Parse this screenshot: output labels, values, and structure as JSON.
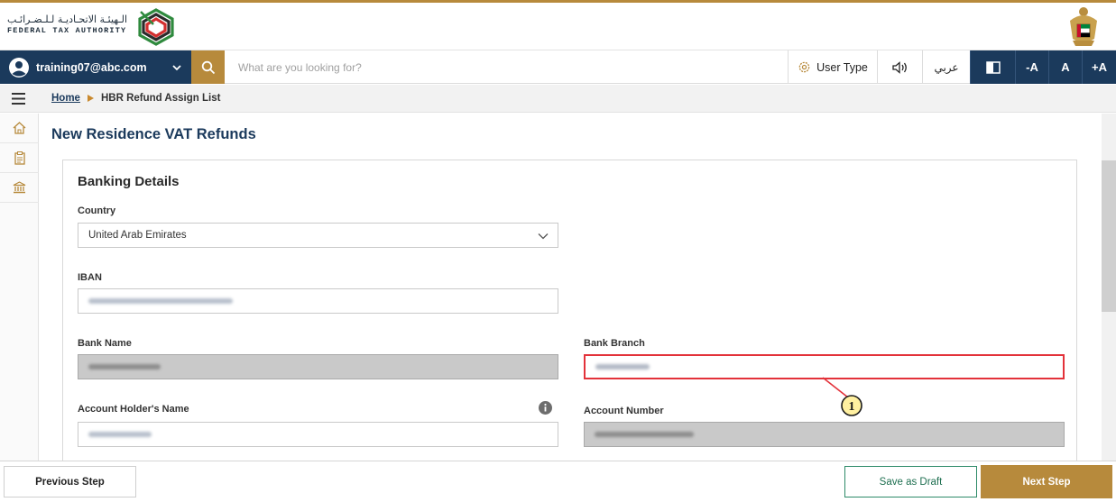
{
  "header": {
    "logo_arabic": "الـهيئـة الاتحـاديـة لـلـضـرائـب",
    "logo_english": "FEDERAL TAX AUTHORITY",
    "brand_green": "#2f8a3e",
    "brand_red": "#d32f2f"
  },
  "topbar": {
    "user_email": "training07@abc.com",
    "search_placeholder": "What are you looking for?",
    "user_type_label": "User Type",
    "arabic_label": "عربي",
    "font_decrease": "-A",
    "font_reset": "A",
    "font_increase": "+A",
    "accent": "#b78a3c",
    "navy": "#1b3a5c"
  },
  "breadcrumb": {
    "home": "Home",
    "current": "HBR Refund Assign List"
  },
  "sidebar": {
    "items": [
      "home-icon",
      "clipboard-icon",
      "bank-icon"
    ]
  },
  "page": {
    "title": "New Residence VAT Refunds"
  },
  "form": {
    "section_title": "Banking Details",
    "country_label": "Country",
    "country_value": "United Arab Emirates",
    "iban_label": "IBAN",
    "bank_name_label": "Bank Name",
    "bank_branch_label": "Bank Branch",
    "account_holder_label": "Account Holder's Name",
    "account_number_label": "Account Number"
  },
  "annotation": {
    "marker": "1",
    "highlight_color": "#e3323a"
  },
  "footer": {
    "previous": "Previous Step",
    "save_draft": "Save as Draft",
    "next": "Next Step"
  }
}
